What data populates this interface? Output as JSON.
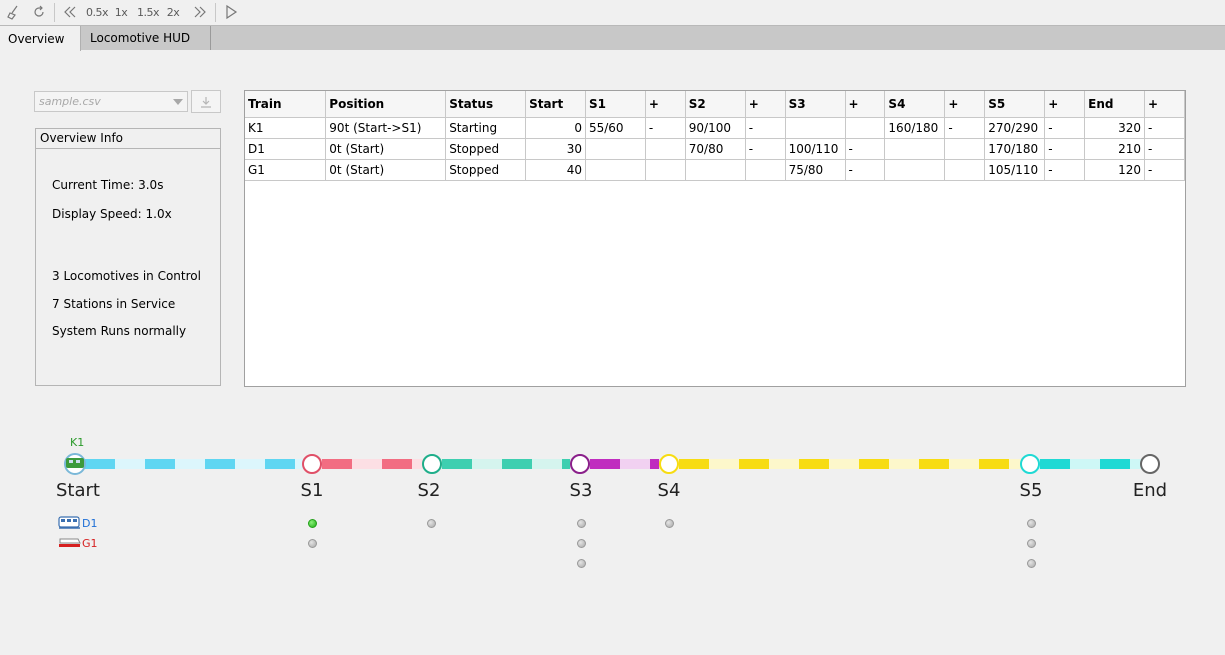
{
  "toolbar": {
    "speed_buttons": [
      "0.5x",
      "1x",
      "1.5x",
      "2x"
    ]
  },
  "tabs": [
    {
      "label": "Overview",
      "active": true
    },
    {
      "label": "Locomotive HUD",
      "active": false
    }
  ],
  "file_select": {
    "value": "sample.csv"
  },
  "overview": {
    "title": "Overview Info",
    "current_time": "Current Time: 3.0s",
    "display_speed": "Display Speed: 1.0x",
    "locomotives": "3 Locomotives in Control",
    "stations": "7 Stations in Service",
    "system": "System Runs normally"
  },
  "table": {
    "headers": [
      "Train",
      "Position",
      "Status",
      "Start",
      "S1",
      "+",
      "S2",
      "+",
      "S3",
      "+",
      "S4",
      "+",
      "S5",
      "+",
      "End",
      "+"
    ],
    "rows": [
      [
        "K1",
        "90t (Start->S1)",
        "Starting",
        "0",
        "55/60",
        "-",
        "90/100",
        "-",
        "",
        "",
        "160/180",
        "-",
        "270/290",
        "-",
        "320",
        "-"
      ],
      [
        "D1",
        "0t (Start)",
        "Stopped",
        "30",
        "",
        "",
        "70/80",
        "-",
        "100/110",
        "-",
        "",
        "",
        "170/180",
        "-",
        "210",
        "-"
      ],
      [
        "G1",
        "0t (Start)",
        "Stopped",
        "40",
        "",
        "",
        "",
        "",
        "75/80",
        "-",
        "",
        "",
        "105/110",
        "-",
        "120",
        "-"
      ]
    ]
  },
  "route": {
    "stations": [
      "Start",
      "S1",
      "S2",
      "S3",
      "S4",
      "S5",
      "End"
    ],
    "active_train_label": "K1",
    "colors": {
      "start_s1": "#5fd6f2",
      "s1_s2": "#f26d82",
      "s2_s3": "#3ecfb0",
      "s3_s4": "#c02cbf",
      "s4_s5": "#f7dc12",
      "s5_end": "#1fd9d4"
    }
  },
  "legend": [
    {
      "label": "D1",
      "color": "#1e6fd6",
      "icon": "train-icon"
    },
    {
      "label": "G1",
      "color": "#d62020",
      "icon": "train-icon"
    }
  ]
}
